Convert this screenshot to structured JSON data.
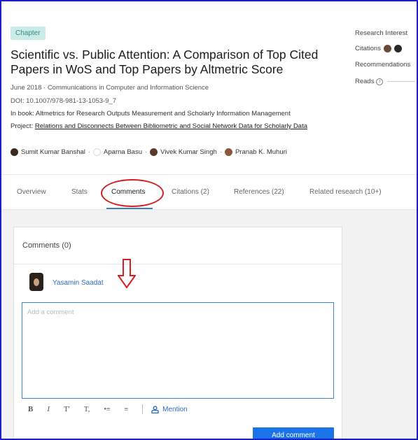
{
  "publication": {
    "type_badge": "Chapter",
    "title": "Scientific vs. Public Attention: A Comparison of Top Cited Papers in WoS and Top Papers by Altmetric Score",
    "date_and_series": "June 2018 · Communications in Computer and Information Science",
    "doi": "DOI: 10.1007/978-981-13-1053-9_7",
    "in_book": "In book: Altmetrics for Research Outputs Measurement and Scholarly Information Management",
    "project_prefix": "Project:",
    "project_link": "Relations and Disconnects Between Bibliometric and Social Network Data for Scholarly Data"
  },
  "authors": [
    {
      "name": "Sumit Kumar Banshal",
      "avatar_color": "#3a2a22"
    },
    {
      "name": "Aparna Basu",
      "avatar_color": "#ffffff"
    },
    {
      "name": "Vivek Kumar Singh",
      "avatar_color": "#5a3a2c"
    },
    {
      "name": "Pranab K. Muhuri",
      "avatar_color": "#8a5a3c"
    }
  ],
  "stats_sidebar": {
    "research_interest": "Research Interest",
    "citations": "Citations",
    "recommendations": "Recommendations",
    "reads": "Reads"
  },
  "tabs": {
    "overview": "Overview",
    "stats": "Stats",
    "comments": "Comments",
    "citations": "Citations (2)",
    "references": "References (22)",
    "related": "Related research (10+)"
  },
  "comments_card": {
    "title": "Comments (0)",
    "user_name": "Yasamin Saadat",
    "placeholder": "Add a comment",
    "toolbar": {
      "bold": "B",
      "italic": "I",
      "superscript": "T'",
      "subscript": "T,",
      "bullet_list": "•≡",
      "numbered_list": "≡",
      "mention": "Mention"
    },
    "submit_label": "Add comment"
  },
  "colors": {
    "accent_blue": "#1a74e8",
    "link_blue": "#2f6cc2",
    "annotation_red": "#d42020",
    "badge_bg": "#c9ece8"
  }
}
